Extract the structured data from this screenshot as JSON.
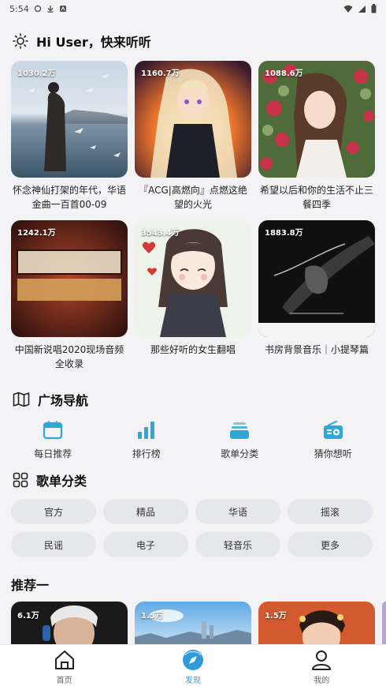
{
  "status_bar": {
    "time": "5:54"
  },
  "greeting": {
    "text": "Hi User，快来听听"
  },
  "playlists": [
    {
      "count": "1030.2万",
      "title": "怀念神仙打架的年代，华语金曲一百首00-09"
    },
    {
      "count": "1160.7万",
      "title": "『ACG|高燃向』点燃这绝望的火光"
    },
    {
      "count": "1088.6万",
      "title": "希望以后和你的生活不止三餐四季"
    },
    {
      "count": "1242.1万",
      "title": "中国新说唱2020现场音频全收录"
    },
    {
      "count": "3543.4万",
      "title": "那些好听的女生翻唱"
    },
    {
      "count": "1883.8万",
      "title": "书房背景音乐｜小提琴篇"
    }
  ],
  "plaza": {
    "title": "广场导航",
    "items": [
      {
        "label": "每日推荐",
        "icon": "calendar-icon"
      },
      {
        "label": "排行榜",
        "icon": "bar-chart-icon"
      },
      {
        "label": "歌单分类",
        "icon": "layers-icon"
      },
      {
        "label": "猜你想听",
        "icon": "radio-icon"
      }
    ],
    "accent": "#2fa8d8"
  },
  "categories": {
    "title": "歌单分类",
    "items": [
      "官方",
      "精品",
      "华语",
      "摇滚",
      "民谣",
      "电子",
      "轻音乐",
      "更多"
    ]
  },
  "recommend": {
    "title": "推荐一",
    "items": [
      {
        "count": "6.1万"
      },
      {
        "count": "1.5万"
      },
      {
        "count": "1.5万"
      }
    ]
  },
  "bottom_nav": {
    "items": [
      {
        "label": "首页",
        "icon": "home-icon"
      },
      {
        "label": "发现",
        "icon": "discover-icon"
      },
      {
        "label": "我的",
        "icon": "user-icon"
      }
    ],
    "active_color": "#2f9bdb"
  }
}
